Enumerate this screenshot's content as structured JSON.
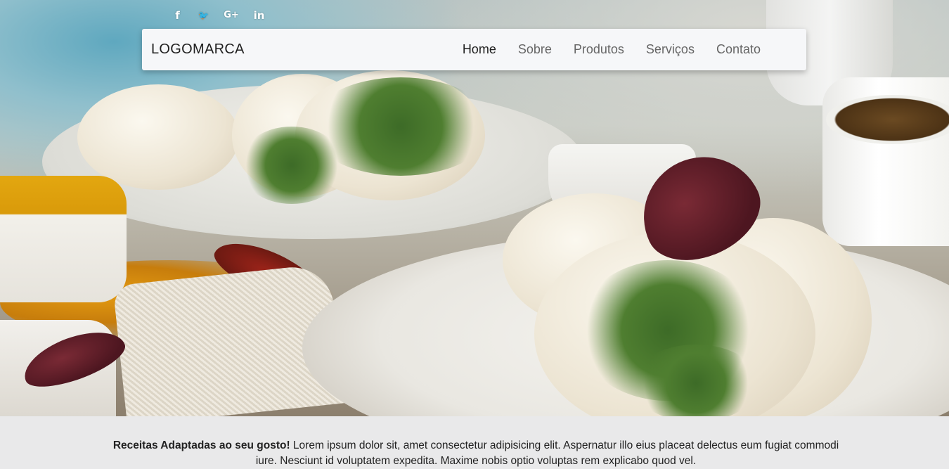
{
  "social": [
    {
      "icon": "facebook-icon",
      "glyph": "f"
    },
    {
      "icon": "twitter-icon",
      "glyph": "🐦"
    },
    {
      "icon": "google-plus-icon",
      "glyph": "G+"
    },
    {
      "icon": "linkedin-icon",
      "glyph": "in"
    }
  ],
  "navbar": {
    "logo": "LOGOMARCA",
    "links": [
      "Home",
      "Sobre",
      "Produtos",
      "Serviços",
      "Contato"
    ],
    "active": "Home"
  },
  "intro": {
    "lead": "Receitas Adaptadas ao seu gosto!",
    "text": " Lorem ipsum dolor sit, amet consectetur adipisicing elit. Aspernatur illo eius placeat delectus eum fugiat commodi iure. Nesciunt id voluptatem expedita. Maxime nobis optio voluptas rem explicabo quod vel."
  },
  "colors": {
    "navbar_bg": "#f6f7f9",
    "section_bg": "#e9e9ea",
    "nav_active": "#1e1e1e",
    "nav_default": "#666666"
  }
}
